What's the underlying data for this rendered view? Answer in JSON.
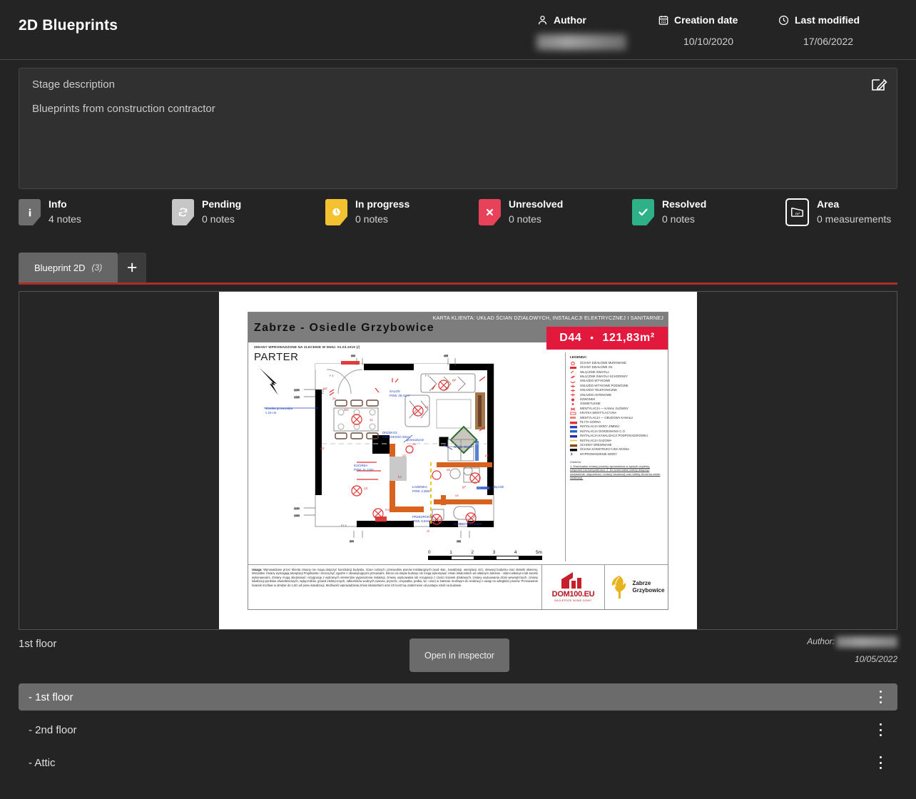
{
  "header": {
    "title": "2D Blueprints",
    "meta": [
      {
        "icon": "person-icon",
        "label": "Author",
        "value": "",
        "redacted": true
      },
      {
        "icon": "calendar-icon",
        "label": "Creation date",
        "value": "10/10/2020",
        "redacted": false
      },
      {
        "icon": "clock-icon",
        "label": "Last modified",
        "value": "17/06/2022",
        "redacted": false
      }
    ]
  },
  "description": {
    "label": "Stage description",
    "text": "Blueprints from construction contractor",
    "edit_icon": "edit-pencil-icon"
  },
  "counters": [
    {
      "title": "Info",
      "sub": "4 notes",
      "icon": "info-icon",
      "color": "#6e6e6e"
    },
    {
      "title": "Pending",
      "sub": "0 notes",
      "icon": "sync-icon",
      "color": "#c6c6c6"
    },
    {
      "title": "In progress",
      "sub": "0 notes",
      "icon": "clock-icon",
      "color": "#f2c230"
    },
    {
      "title": "Unresolved",
      "sub": "0 notes",
      "icon": "close-x-icon",
      "color": "#e8425a"
    },
    {
      "title": "Resolved",
      "sub": "0 notes",
      "icon": "check-icon",
      "color": "#2eb186"
    },
    {
      "title": "Area",
      "sub": "0 measurements",
      "icon": "area-measure-icon",
      "color": "#ffffff"
    }
  ],
  "tabs": {
    "items": [
      {
        "label": "Blueprint 2D",
        "count": "(3)",
        "active": true
      }
    ],
    "add_label": "+",
    "accent_color": "#b02a2a"
  },
  "blueprint": {
    "kart_header": "KARTA KLIENTA: UKŁAD ŚCIAN DZIAŁOWYCH, INSTALACJI ELEKTRYCZNEJ I SANITARNEJ",
    "city_title": "Zabrze - Osiedle Grzybowice",
    "change_note": "ZMIANY WPROWADZONE NA ZLECENIE W DNIU: 01.03.2019  (/)",
    "level": "PARTER",
    "unit_code": "D44",
    "unit_area": "121,83m²",
    "badge_color": "#e2183c",
    "legend_title": "LEGENDA:",
    "legend": [
      {
        "symbol": "circle-red",
        "text": "ŚCIANY DZIAŁOWE MUROWANE"
      },
      {
        "symbol": "block-red",
        "text": "ŚCIANY DZIAŁOWE GK"
      },
      {
        "symbol": "line-red",
        "text": "WŁĄCZNIK ŚWIATŁA"
      },
      {
        "symbol": "line-red",
        "text": "WŁĄCZNIK ŚWIATŁA SCHODOWY"
      },
      {
        "symbol": "line-red",
        "text": "GNIAZDO WTYKOWE"
      },
      {
        "symbol": "cross-red",
        "text": "GNIAZDO WTYKOWE PODWÓJNE"
      },
      {
        "symbol": "cross-red",
        "text": "GNIAZDO TELEFONICZNE"
      },
      {
        "symbol": "cross-red",
        "text": "GNIAZDO ANTENOWE"
      },
      {
        "symbol": "dot-red",
        "text": "DZWONEK"
      },
      {
        "symbol": "dot-red",
        "text": "OŚWIETLENIE"
      },
      {
        "symbol": "sym-red",
        "text": "WENTYLACJA — KANAŁ GŁÓWNY"
      },
      {
        "symbol": "sym-red",
        "text": "KRATKA WENTYLACYJNA"
      },
      {
        "symbol": "sym-red",
        "text": "WENTYLACJA — OBUDOWA KANAŁU"
      },
      {
        "symbol": "bar-red",
        "text": "PŁYTA GÓRNA"
      },
      {
        "symbol": "bar-blue",
        "text": "INSTALACJA WODY ZIMNEJ"
      },
      {
        "symbol": "bar-blue",
        "text": "INSTALACJA OGRZEWANIA C.O."
      },
      {
        "symbol": "bar-blue",
        "text": "INSTALACJA KANALIZACJI PODPOSADZKOWEJ"
      },
      {
        "symbol": "line-yellow",
        "text": "INSTALACJA GAZOWA"
      },
      {
        "symbol": "bar-brown",
        "text": "SCHODY DREWNIANE"
      },
      {
        "symbol": "bar-black",
        "text": "ŚCIANA KONSTRUKCYJNA NOŚNA"
      },
      {
        "symbol": "sym-blue",
        "text": "WYPROWADZENIE WODY"
      }
    ],
    "legend_note_title": "UWAGA:",
    "legend_note": "1. Ewentualne zmiany prosimy wprowadzać w sposób czytelny, odręcznie lub komputerowo. 2. Do schematów należy dołączyć zestawienie: włączników i zmiany lokalizacji oraz tabelę zliczenia zmian lokalizacji.",
    "uwaga_label": "Uwaga:",
    "uwaga_text": "Wprowadzane przez Klienta zmiany nie mogą dotyczyć konstrukcji budynku, ścian nośnych, przewodów pionów instalacyjnych (wod.-kan., kanalizacji, wentylacji, itd.), elewacji budynku oraz stolarki okiennej. Wszystkie zmiany wymagają akceptacji Projektanta i muszą być zgodne z obowiązującymi przepisami. Klienci na etapie budowy nie mogą wykonywać zmian lokatorskich we własnym zakresie - silami własnymi lub swoimi wykonawcami. Zmiany mogą obejmować: rezygnację z wybranych elementów wyposażenia instalacji, zmiany usytuowania lub rezygnacji z części ścianek działowych, zmiany usytuowania drzwi wewnętrznych, zmiany lokalizacji punktów oświetleniowych, wyłączników, gniazd elektrycznych, odbiorników wodnych (wanna, prysznic, umywalka, pralka, wc i inne) w zakresie możliwym do realizacji z uwagi na odległości pionów. Przesuwanie ścianek możliwe w obrębie do 1,0m od pionu kanalizacji. Możliwość wprowadzania zmian lokatorskich oraz ich koszt są uzależnione od postępu robót na budowie.",
    "logo_main": "DOM100.EU",
    "logo_sub": "NAJLEPSZE NOWE DOMY",
    "logo_city_line1": "Zabrze",
    "logo_city_line2": "Grzybowice",
    "scale_labels": [
      "0",
      "1",
      "2",
      "3",
      "4",
      "5m"
    ]
  },
  "under_viewer": {
    "floor_label": "1st floor",
    "inspector_button": "Open in inspector",
    "author_prefix": "Author:",
    "author_name": "",
    "date": "10/05/2022"
  },
  "floor_list": [
    {
      "label": "- 1st floor",
      "selected": true,
      "menu_icon": "kebab-menu-icon"
    },
    {
      "label": "- 2nd floor",
      "selected": false,
      "menu_icon": "kebab-menu-icon"
    },
    {
      "label": "- Attic",
      "selected": false,
      "menu_icon": "kebab-menu-icon"
    }
  ]
}
